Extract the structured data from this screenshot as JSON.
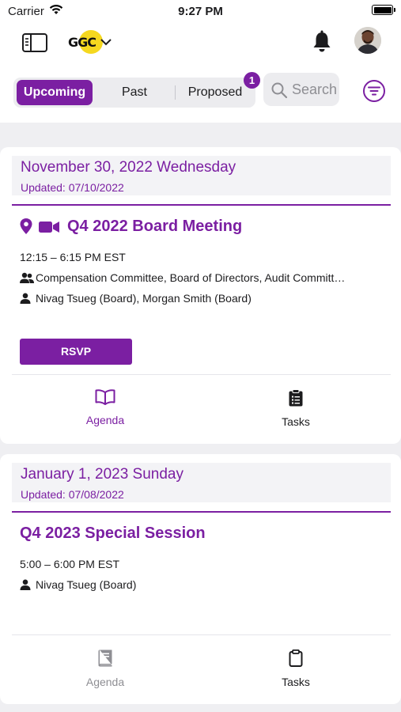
{
  "status_bar": {
    "carrier": "Carrier",
    "time": "9:27 PM"
  },
  "header": {
    "logo_text": "GGC",
    "segments": [
      {
        "label": "Upcoming",
        "active": true
      },
      {
        "label": "Past",
        "active": false
      },
      {
        "label": "Proposed",
        "active": false
      }
    ],
    "proposed_badge": "1",
    "search_placeholder": "Search"
  },
  "colors": {
    "accent": "#7b1fa2",
    "muted": "#8e8e93",
    "background": "#efeff2",
    "logo_yellow": "#f5d81f"
  },
  "meetings": [
    {
      "date": "November 30, 2022 Wednesday",
      "updated": "Updated: 07/10/2022",
      "title": "Q4 2022 Board Meeting",
      "icons": [
        "location-pin-icon",
        "video-camera-icon"
      ],
      "time": "12:15 – 6:15 PM EST",
      "committees": "Compensation Committee, Board of Directors, Audit Committ…",
      "attendees": "Nivag Tsueg (Board), Morgan Smith (Board)",
      "rsvp_label": "RSVP",
      "agenda_label": "Agenda",
      "tasks_label": "Tasks",
      "agenda_enabled": true
    },
    {
      "date": "January 1, 2023 Sunday",
      "updated": "Updated: 07/08/2022",
      "title": "Q4 2023 Special Session",
      "time": "5:00 – 6:00 PM EST",
      "attendees": "Nivag Tsueg (Board)",
      "agenda_label": "Agenda",
      "tasks_label": "Tasks",
      "agenda_enabled": false
    }
  ]
}
